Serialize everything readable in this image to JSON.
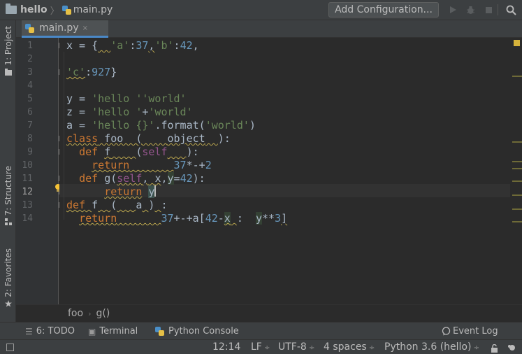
{
  "navbar": {
    "project": "hello",
    "file": "main.py",
    "add_configuration": "Add Configuration...",
    "icons": [
      "run-icon",
      "debug-icon",
      "stop-icon",
      "search-icon"
    ]
  },
  "left_strip": {
    "project_tab": "1: Project",
    "structure_tab": "7: Structure",
    "favorites_tab": "2: Favorites"
  },
  "editor": {
    "tab_label": "main.py",
    "tab_close": "×",
    "line_numbers": [
      "1",
      "2",
      "3",
      "4",
      "5",
      "6",
      "7",
      "8",
      "9",
      "10",
      "11",
      "12",
      "13",
      "14"
    ],
    "current_line": "12"
  },
  "code": {
    "l1_a": "x = {",
    "l1_b": "'a'",
    "l1_c": ":",
    "l1_d": "37",
    "l1_e": ",",
    "l1_f": "'b'",
    "l1_g": ":",
    "l1_h": "42",
    "l1_i": ",",
    "l3_a": "'c'",
    "l3_b": ":",
    "l3_c": "927",
    "l3_d": "}",
    "l5_a": "y = ",
    "l5_b": "'hello '",
    "l5_c": "'world'",
    "l6_a": "z = ",
    "l6_b": "'hello '",
    "l6_c": "+",
    "l6_d": "'world'",
    "l7_a": "a = ",
    "l7_b": "'hello {}'",
    "l7_c": ".format(",
    "l7_d": "'world'",
    "l7_e": ")",
    "l8_a": "class",
    "l8_b": " foo  (",
    "l8_c": "object",
    "l8_d": "):",
    "l9_a": "def",
    "l9_b": "f",
    "l9_c": "(",
    "l9_d": "self",
    "l9_e": "):",
    "l10_a": "return",
    "l10_b": "37",
    "l10_c": "*-+",
    "l10_d": "2",
    "l11_a": "def",
    "l11_b": "g",
    "l11_c": "(",
    "l11_d": "self",
    "l11_e": ",",
    "l11_f": "x",
    "l11_g": ",",
    "l11_h": "y",
    "l11_i": "=",
    "l11_j": "42",
    "l11_k": "):",
    "l12_a": "return",
    "l12_b": "y",
    "l13_a": "def",
    "l13_b": "f",
    "l13_c": "(",
    "l13_d": "a",
    "l13_e": ")",
    "l13_f": ":",
    "l14_a": "return",
    "l14_b": "37",
    "l14_c": "+-+a[",
    "l14_d": "42",
    "l14_e": "-",
    "l14_f": "x",
    "l14_g": ":",
    "l14_h": "y",
    "l14_i": "**",
    "l14_j": "3",
    "l14_k": "]"
  },
  "breadcrumbs": {
    "item1": "foo",
    "item2": "g()"
  },
  "tool_windows": {
    "todo": "6: TODO",
    "terminal": "Terminal",
    "python_console": "Python Console",
    "event_log": "Event Log"
  },
  "status": {
    "position": "12:14",
    "line_separator": "LF",
    "encoding": "UTF-8",
    "indent": "4 spaces",
    "interpreter": "Python 3.6 (hello)"
  },
  "colors": {
    "keyword": "#cc7832",
    "string": "#6a8759",
    "number": "#6897bb",
    "self": "#94558d",
    "identifier": "#a9b7c6",
    "background": "#2b2b2b"
  }
}
